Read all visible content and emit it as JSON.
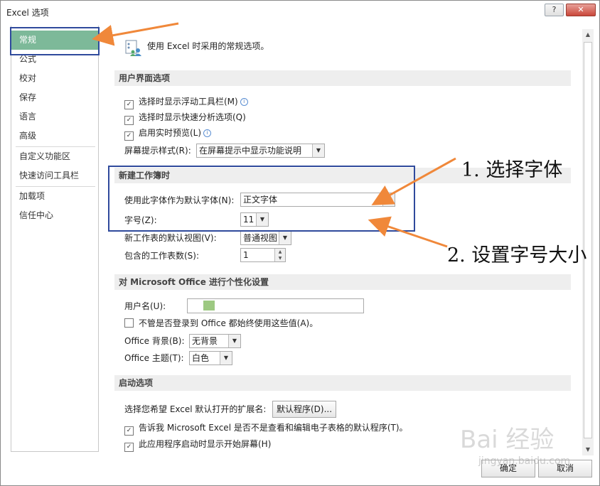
{
  "window": {
    "title": "Excel 选项",
    "help_label": "?",
    "close_label": "✕"
  },
  "sidebar": {
    "items": [
      {
        "label": "常规",
        "selected": true
      },
      {
        "label": "公式"
      },
      {
        "label": "校对"
      },
      {
        "label": "保存"
      },
      {
        "label": "语言"
      },
      {
        "label": "高级"
      },
      {
        "label": "自定义功能区"
      },
      {
        "label": "快速访问工具栏"
      },
      {
        "label": "加载项"
      },
      {
        "label": "信任中心"
      }
    ]
  },
  "header": {
    "text": "使用 Excel 时采用的常规选项。",
    "icon": "gear-people-icon"
  },
  "ui_options": {
    "title": "用户界面选项",
    "show_mini_toolbar": "选择时显示浮动工具栏(M)",
    "show_quick_analysis": "选择时显示快速分析选项(Q)",
    "live_preview": "启用实时预览(L)",
    "screentip_label": "屏幕提示样式(R):",
    "screentip_value": "在屏幕提示中显示功能说明"
  },
  "new_workbook": {
    "title": "新建工作簿时",
    "font_label": "使用此字体作为默认字体(N):",
    "font_value": "正文字体",
    "size_label": "字号(Z):",
    "size_value": "11",
    "view_label": "新工作表的默认视图(V):",
    "view_value": "普通视图",
    "sheets_label": "包含的工作表数(S):",
    "sheets_value": "1"
  },
  "personalize": {
    "title": "对 Microsoft Office 进行个性化设置",
    "username_label": "用户名(U):",
    "always_use": "不管是否登录到 Office 都始终使用这些值(A)。",
    "background_label": "Office 背景(B):",
    "background_value": "无背景",
    "theme_label": "Office 主题(T):",
    "theme_value": "白色"
  },
  "startup": {
    "title": "启动选项",
    "ext_label": "选择您希望 Excel 默认打开的扩展名:",
    "default_programs": "默认程序(D)...",
    "tell_me": "告诉我 Microsoft Excel 是否不是查看和编辑电子表格的默认程序(T)。",
    "show_start": "此应用程序启动时显示开始屏幕(H)"
  },
  "annotations": {
    "step1": "1. 选择字体",
    "step2": "2. 设置字号大小"
  },
  "footer": {
    "ok": "确定",
    "cancel": "取消"
  },
  "watermark": {
    "logo": "Bai 经验",
    "url": "jingyan.baidu.com"
  },
  "colors": {
    "selected": "#7db999",
    "annotation_box": "#2f4a9c",
    "arrow": "#f0883a"
  }
}
